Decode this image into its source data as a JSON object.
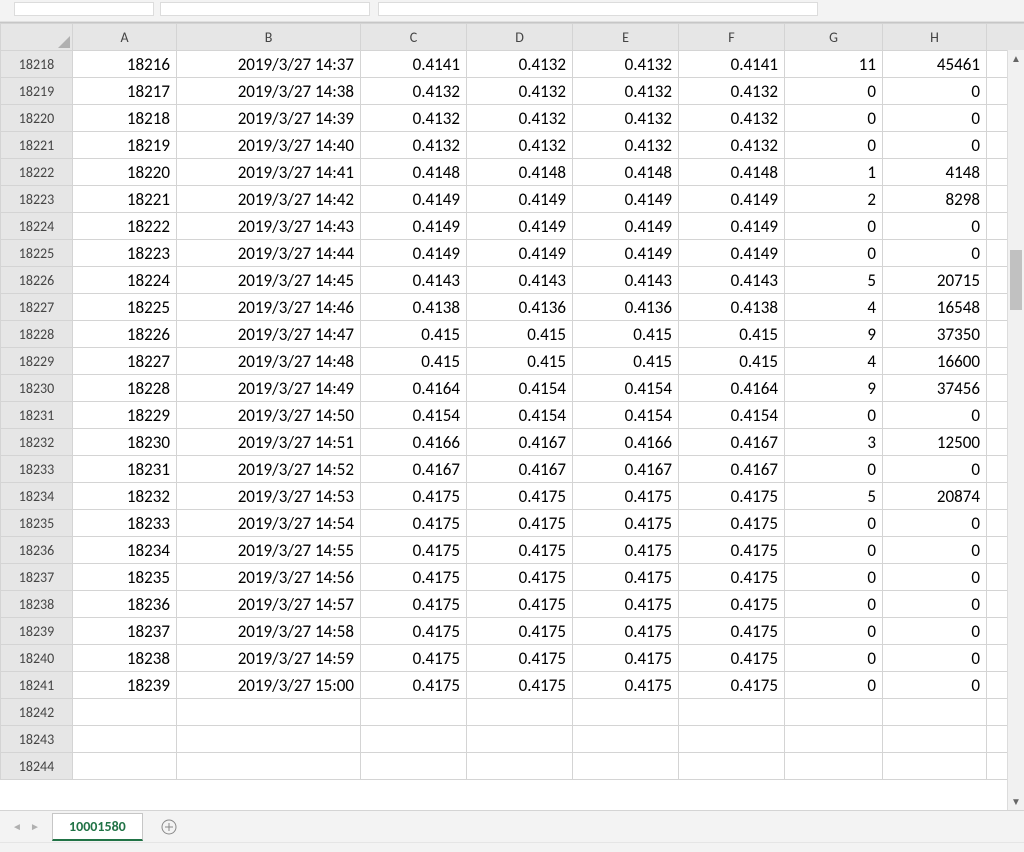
{
  "app": {
    "accent": "#217346"
  },
  "sheet": {
    "active_tab": "10001580"
  },
  "columns": [
    "A",
    "B",
    "C",
    "D",
    "E",
    "F",
    "G",
    "H"
  ],
  "row_header_start": 18218,
  "row_count_visible": 27,
  "data_rows": [
    {
      "n": 18218,
      "A": "18216",
      "B": "2019/3/27 14:37",
      "C": "0.4141",
      "D": "0.4132",
      "E": "0.4132",
      "F": "0.4141",
      "G": "11",
      "H": "45461"
    },
    {
      "n": 18219,
      "A": "18217",
      "B": "2019/3/27 14:38",
      "C": "0.4132",
      "D": "0.4132",
      "E": "0.4132",
      "F": "0.4132",
      "G": "0",
      "H": "0"
    },
    {
      "n": 18220,
      "A": "18218",
      "B": "2019/3/27 14:39",
      "C": "0.4132",
      "D": "0.4132",
      "E": "0.4132",
      "F": "0.4132",
      "G": "0",
      "H": "0"
    },
    {
      "n": 18221,
      "A": "18219",
      "B": "2019/3/27 14:40",
      "C": "0.4132",
      "D": "0.4132",
      "E": "0.4132",
      "F": "0.4132",
      "G": "0",
      "H": "0"
    },
    {
      "n": 18222,
      "A": "18220",
      "B": "2019/3/27 14:41",
      "C": "0.4148",
      "D": "0.4148",
      "E": "0.4148",
      "F": "0.4148",
      "G": "1",
      "H": "4148"
    },
    {
      "n": 18223,
      "A": "18221",
      "B": "2019/3/27 14:42",
      "C": "0.4149",
      "D": "0.4149",
      "E": "0.4149",
      "F": "0.4149",
      "G": "2",
      "H": "8298"
    },
    {
      "n": 18224,
      "A": "18222",
      "B": "2019/3/27 14:43",
      "C": "0.4149",
      "D": "0.4149",
      "E": "0.4149",
      "F": "0.4149",
      "G": "0",
      "H": "0"
    },
    {
      "n": 18225,
      "A": "18223",
      "B": "2019/3/27 14:44",
      "C": "0.4149",
      "D": "0.4149",
      "E": "0.4149",
      "F": "0.4149",
      "G": "0",
      "H": "0"
    },
    {
      "n": 18226,
      "A": "18224",
      "B": "2019/3/27 14:45",
      "C": "0.4143",
      "D": "0.4143",
      "E": "0.4143",
      "F": "0.4143",
      "G": "5",
      "H": "20715"
    },
    {
      "n": 18227,
      "A": "18225",
      "B": "2019/3/27 14:46",
      "C": "0.4138",
      "D": "0.4136",
      "E": "0.4136",
      "F": "0.4138",
      "G": "4",
      "H": "16548"
    },
    {
      "n": 18228,
      "A": "18226",
      "B": "2019/3/27 14:47",
      "C": "0.415",
      "D": "0.415",
      "E": "0.415",
      "F": "0.415",
      "G": "9",
      "H": "37350"
    },
    {
      "n": 18229,
      "A": "18227",
      "B": "2019/3/27 14:48",
      "C": "0.415",
      "D": "0.415",
      "E": "0.415",
      "F": "0.415",
      "G": "4",
      "H": "16600"
    },
    {
      "n": 18230,
      "A": "18228",
      "B": "2019/3/27 14:49",
      "C": "0.4164",
      "D": "0.4154",
      "E": "0.4154",
      "F": "0.4164",
      "G": "9",
      "H": "37456"
    },
    {
      "n": 18231,
      "A": "18229",
      "B": "2019/3/27 14:50",
      "C": "0.4154",
      "D": "0.4154",
      "E": "0.4154",
      "F": "0.4154",
      "G": "0",
      "H": "0"
    },
    {
      "n": 18232,
      "A": "18230",
      "B": "2019/3/27 14:51",
      "C": "0.4166",
      "D": "0.4167",
      "E": "0.4166",
      "F": "0.4167",
      "G": "3",
      "H": "12500"
    },
    {
      "n": 18233,
      "A": "18231",
      "B": "2019/3/27 14:52",
      "C": "0.4167",
      "D": "0.4167",
      "E": "0.4167",
      "F": "0.4167",
      "G": "0",
      "H": "0"
    },
    {
      "n": 18234,
      "A": "18232",
      "B": "2019/3/27 14:53",
      "C": "0.4175",
      "D": "0.4175",
      "E": "0.4175",
      "F": "0.4175",
      "G": "5",
      "H": "20874"
    },
    {
      "n": 18235,
      "A": "18233",
      "B": "2019/3/27 14:54",
      "C": "0.4175",
      "D": "0.4175",
      "E": "0.4175",
      "F": "0.4175",
      "G": "0",
      "H": "0"
    },
    {
      "n": 18236,
      "A": "18234",
      "B": "2019/3/27 14:55",
      "C": "0.4175",
      "D": "0.4175",
      "E": "0.4175",
      "F": "0.4175",
      "G": "0",
      "H": "0"
    },
    {
      "n": 18237,
      "A": "18235",
      "B": "2019/3/27 14:56",
      "C": "0.4175",
      "D": "0.4175",
      "E": "0.4175",
      "F": "0.4175",
      "G": "0",
      "H": "0"
    },
    {
      "n": 18238,
      "A": "18236",
      "B": "2019/3/27 14:57",
      "C": "0.4175",
      "D": "0.4175",
      "E": "0.4175",
      "F": "0.4175",
      "G": "0",
      "H": "0"
    },
    {
      "n": 18239,
      "A": "18237",
      "B": "2019/3/27 14:58",
      "C": "0.4175",
      "D": "0.4175",
      "E": "0.4175",
      "F": "0.4175",
      "G": "0",
      "H": "0"
    },
    {
      "n": 18240,
      "A": "18238",
      "B": "2019/3/27 14:59",
      "C": "0.4175",
      "D": "0.4175",
      "E": "0.4175",
      "F": "0.4175",
      "G": "0",
      "H": "0"
    },
    {
      "n": 18241,
      "A": "18239",
      "B": "2019/3/27 15:00",
      "C": "0.4175",
      "D": "0.4175",
      "E": "0.4175",
      "F": "0.4175",
      "G": "0",
      "H": "0"
    },
    {
      "n": 18242
    },
    {
      "n": 18243
    },
    {
      "n": 18244
    }
  ]
}
